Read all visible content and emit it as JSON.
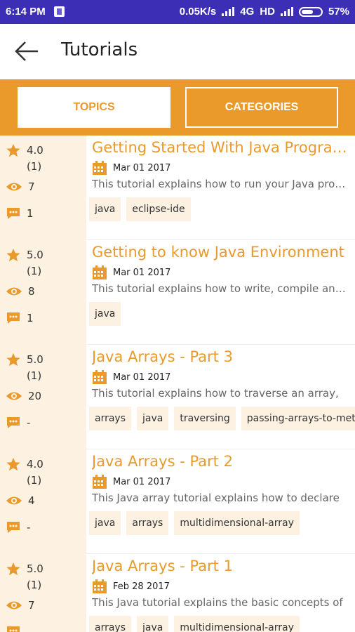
{
  "status_bar": {
    "time": "6:14 PM",
    "speed": "0.05K/s",
    "network": "4G",
    "hd": "HD",
    "battery": "57%"
  },
  "app_bar": {
    "title": "Tutorials",
    "back_icon": "arrow-left-icon"
  },
  "tabs": [
    {
      "label": "TOPICS",
      "selected": false
    },
    {
      "label": "CATEGORIES",
      "selected": true
    }
  ],
  "colors": {
    "accent": "#e99a2b",
    "status_bar": "#3c2fb6",
    "side_panel": "#fdf1e1"
  },
  "tutorials": [
    {
      "rating": "4.0",
      "rating_count": "(1)",
      "views": "7",
      "comments": "1",
      "title": "Getting Started With Java Programming",
      "date": "Mar 01 2017",
      "description": "This tutorial explains how to run your Java programs",
      "tags": [
        "java",
        "eclipse-ide"
      ]
    },
    {
      "rating": "5.0",
      "rating_count": "(1)",
      "views": "8",
      "comments": "1",
      "title": "Getting to know Java Environment",
      "date": "Mar 01 2017",
      "description": "This tutorial explains how to write, compile and run",
      "tags": [
        "java"
      ]
    },
    {
      "rating": "5.0",
      "rating_count": "(1)",
      "views": "20",
      "comments": "-",
      "title": "Java Arrays - Part 3",
      "date": "Mar 01 2017",
      "description": "This tutorial explains how to traverse an array,",
      "tags": [
        "arrays",
        "java",
        "traversing",
        "passing-arrays-to-meth"
      ]
    },
    {
      "rating": "4.0",
      "rating_count": "(1)",
      "views": "4",
      "comments": "-",
      "title": "Java Arrays - Part 2",
      "date": "Mar 01 2017",
      "description": "This Java array tutorial explains how to declare",
      "tags": [
        "java",
        "arrays",
        "multidimensional-array"
      ]
    },
    {
      "rating": "5.0",
      "rating_count": "(1)",
      "views": "7",
      "comments": "-",
      "title": "Java Arrays - Part 1",
      "date": "Feb 28 2017",
      "description": "This Java tutorial explains the basic concepts of",
      "tags": [
        "arrays",
        "java",
        "multidimensional-array"
      ]
    }
  ]
}
